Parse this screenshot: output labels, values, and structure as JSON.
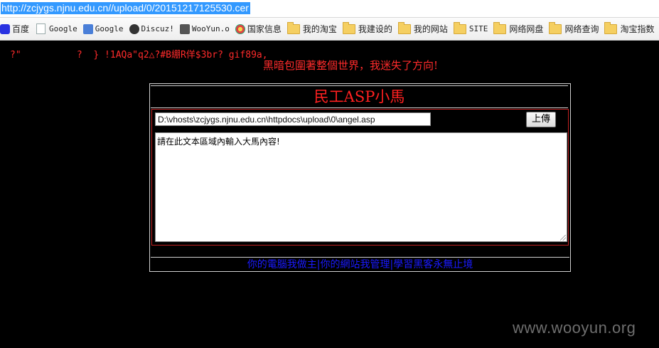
{
  "browser": {
    "url": "http://zcjygs.njnu.edu.cn//upload/0/20151217125530.cer"
  },
  "bookmarks": [
    {
      "label": "百度",
      "icon": "baidu-icon"
    },
    {
      "label": "Google",
      "icon": "page-icon"
    },
    {
      "label": "Google",
      "icon": "google-translate-icon"
    },
    {
      "label": "Discuz!",
      "icon": "discuz-icon"
    },
    {
      "label": "WooYun.o",
      "icon": "wooyun-icon"
    },
    {
      "label": "国家信息",
      "icon": "gov-emblem-icon"
    },
    {
      "label": "我的淘宝",
      "icon": "folder-icon"
    },
    {
      "label": "我建设的",
      "icon": "folder-icon"
    },
    {
      "label": "我的网站",
      "icon": "folder-icon"
    },
    {
      "label": "SITE",
      "icon": "folder-icon"
    },
    {
      "label": "网络网盘",
      "icon": "folder-icon"
    },
    {
      "label": "网络查询",
      "icon": "folder-icon"
    },
    {
      "label": "淘宝指数",
      "icon": "folder-icon"
    },
    {
      "label": "",
      "icon": "folder-icon"
    }
  ],
  "page": {
    "garbled_text": "?\"          ?  } !1AQa\"q2△?#B綳R佯$3br? gif89a,",
    "slogan": "黑暗包圍著整個世界，我迷失了方向!",
    "title": "民工ASP小馬",
    "path_value": "D:\\vhosts\\zcjygs.njnu.edu.cn\\httpdocs\\upload\\0\\angel.asp",
    "upload_button": "上傳",
    "textarea_content": "請在此文本區域內輸入大馬內容!",
    "footer_links": [
      "你的電腦我做主",
      "你的網站我管理",
      "學習黑客永無止境"
    ],
    "footer_separator": "|"
  },
  "watermark": "www.wooyun.org",
  "colors": {
    "background": "#000000",
    "accent_red": "#ff2b2b",
    "link_blue": "#1a1aff",
    "url_highlight": "#3399ff"
  }
}
